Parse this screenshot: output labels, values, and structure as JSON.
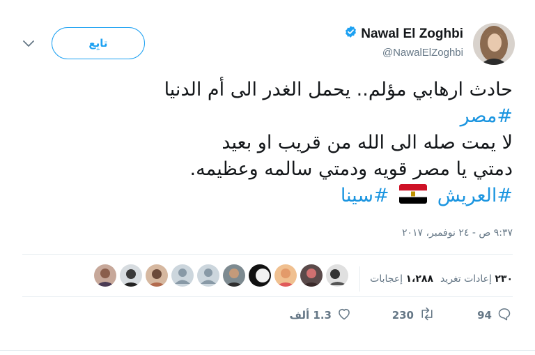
{
  "header": {
    "display_name": "Nawal El Zoghbi",
    "handle": "@NawalElZoghbi",
    "follow_label": "تابِع"
  },
  "tweet": {
    "line1": "حادث ارهابي مؤلم.. يحمل الغدر الى أم الدنيا",
    "hashtag_egypt": "#مصر",
    "line3": "لا يمت صله الى الله من قريب او بعيد",
    "line4": "دمتي يا مصر قويه ودمتي سالمه وعظيمه.",
    "hashtag_arish": "#العريش",
    "hashtag_sinai": "#سينا",
    "flag_icon": "egypt-flag"
  },
  "timestamp": "٩:٣٧ ص - ٢٤ نوفمبر، ٢٠١٧",
  "stats": {
    "retweets_count": "٢٣٠",
    "retweets_label": "إعادات تغريد",
    "likes_count": "١،٢٨٨",
    "likes_label": "إعجابات"
  },
  "actions": {
    "replies": "94",
    "retweets": "230",
    "likes": "1.3 ألف"
  },
  "colors": {
    "accent": "#1da1f2",
    "hashtag": "#1b95e0",
    "muted": "#657786",
    "divider": "#e6ecf0"
  }
}
